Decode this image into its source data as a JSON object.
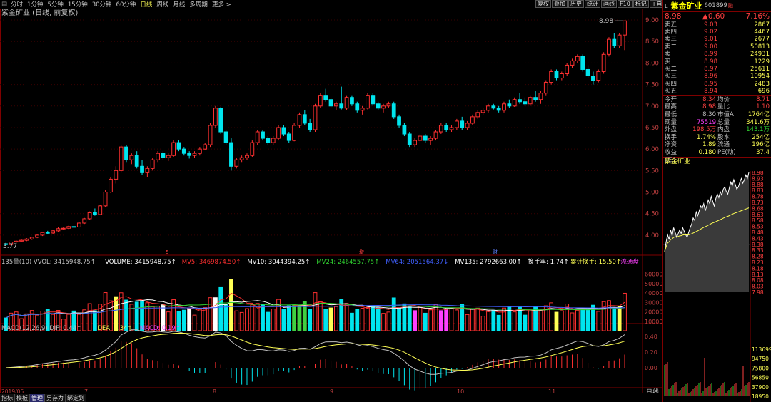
{
  "toolbar": {
    "items": [
      {
        "label": "分时",
        "active": false
      },
      {
        "label": "1分钟",
        "active": false
      },
      {
        "label": "5分钟",
        "active": false
      },
      {
        "label": "15分钟",
        "active": false
      },
      {
        "label": "30分钟",
        "active": false
      },
      {
        "label": "60分钟",
        "active": false
      },
      {
        "label": "日线",
        "active": true
      },
      {
        "label": "周线",
        "active": false
      },
      {
        "label": "月线",
        "active": false
      },
      {
        "label": "多周期",
        "active": false
      },
      {
        "label": "更多 >",
        "active": false
      }
    ],
    "right_buttons": [
      "复权",
      "叠加",
      "历史",
      "统计",
      "画线",
      "F10",
      "标记",
      "+自选",
      "返回"
    ]
  },
  "chart": {
    "title": "紫金矿业 (日线, 前复权)",
    "price_axis": [
      "9.00",
      "8.50",
      "8.00",
      "7.50",
      "7.00",
      "6.50",
      "6.00",
      "5.50",
      "5.00",
      "4.50",
      "4.00"
    ],
    "high_label": "8.98",
    "low_label": "3.77",
    "marker_labels": [
      "5",
      "增",
      "财"
    ],
    "volume_header": [
      {
        "text": "135量(10) VVOL: 3415948.75↑",
        "color": "#c0c0c0"
      },
      {
        "text": "VOLUME: 3415948.75↑",
        "color": "#ffffff"
      },
      {
        "text": "MV5: 3469874.50↑",
        "color": "#ff3030"
      },
      {
        "text": "MV10: 3044394.25↑",
        "color": "#ffffff"
      },
      {
        "text": "MV24: 2464557.75↑",
        "color": "#30d030"
      },
      {
        "text": "MV64: 2051564.37↓",
        "color": "#4060ff"
      },
      {
        "text": "MV135: 2792663.00↑",
        "color": "#ffffff"
      },
      {
        "text": "换手率: 1.74↑",
        "color": "#ffffff"
      },
      {
        "text": "累计换手: 15.50↑",
        "color": "#ffff55"
      },
      {
        "text": "流通盘",
        "color": "#ff40ff"
      }
    ],
    "volume_axis": [
      "60000",
      "50000",
      "40000",
      "30000",
      "20000",
      "10000"
    ],
    "macd_header": [
      {
        "text": "MACD(12,26,9) DIF: 0.44↑",
        "color": "#c0c0c0"
      },
      {
        "text": "DEA: 0.34↑",
        "color": "#ffff55"
      },
      {
        "text": "MACD: 0.19↑",
        "color": "#ff40ff"
      }
    ],
    "macd_axis": [
      "0.40",
      "0.20",
      "0.00"
    ],
    "date_axis": [
      "7",
      "8",
      "9",
      "10",
      "11"
    ],
    "date_year": "2019/06",
    "period_label": "日线"
  },
  "bottom_tabs": [
    {
      "label": "指标",
      "active": false
    },
    {
      "label": "模板",
      "active": false
    },
    {
      "label": "管理",
      "active": true
    },
    {
      "label": "另存为",
      "active": false
    },
    {
      "label": "绑定到",
      "active": false
    }
  ],
  "quote": {
    "mark": "L",
    "name": "紫金矿业",
    "code": "601899",
    "badge": "融",
    "price": "8.98",
    "change": "▲0.60",
    "change_pct": "7.16%",
    "asks": [
      {
        "label": "卖五",
        "price": "9.03",
        "vol": "2867"
      },
      {
        "label": "卖四",
        "price": "9.02",
        "vol": "4467"
      },
      {
        "label": "卖三",
        "price": "9.01",
        "vol": "2677"
      },
      {
        "label": "卖二",
        "price": "9.00",
        "vol": "50813"
      },
      {
        "label": "卖一",
        "price": "8.99",
        "vol": "24931"
      }
    ],
    "bids": [
      {
        "label": "买一",
        "price": "8.98",
        "vol": "1229"
      },
      {
        "label": "买二",
        "price": "8.97",
        "vol": "25611"
      },
      {
        "label": "买三",
        "price": "8.96",
        "vol": "10954"
      },
      {
        "label": "买四",
        "price": "8.95",
        "vol": "2483"
      },
      {
        "label": "买五",
        "price": "8.94",
        "vol": "696"
      }
    ],
    "stats": [
      {
        "k": "今开",
        "a": "8.34",
        "ac": "#ff4040",
        "k2": "均价",
        "b": "8.71",
        "bc": "#ff4040"
      },
      {
        "k": "最高",
        "a": "8.98",
        "ac": "#ff4040",
        "k2": "量比",
        "b": "1.10",
        "bc": "#ff4040"
      },
      {
        "k": "最低",
        "a": "8.30",
        "ac": "#c0c0c0",
        "k2": "市值A",
        "b": "1764亿",
        "bc": "#ffff55"
      },
      {
        "k": "现量",
        "a": "75519",
        "ac": "#ff40ff",
        "k2": "总量",
        "b": "341.6万",
        "bc": "#ffff55"
      },
      {
        "k": "外盘",
        "a": "198.5万",
        "ac": "#ff4040",
        "k2": "内盘",
        "b": "143.1万",
        "bc": "#30d030"
      },
      {
        "k": "换手",
        "a": "1.74%",
        "ac": "#ffff55",
        "k2": "股本",
        "b": "254亿",
        "bc": "#ffff55"
      },
      {
        "k": "净资",
        "a": "1.89",
        "ac": "#ffff55",
        "k2": "流通",
        "b": "196亿",
        "bc": "#ffff55"
      },
      {
        "k": "收益(三)",
        "a": "0.180",
        "ac": "#ffff55",
        "k2": "PE(动)",
        "b": "37.4",
        "bc": "#ffff55"
      }
    ],
    "mini_title": "紫金矿业",
    "mini_price_axis": [
      "8.98",
      "8.93",
      "8.88",
      "8.83",
      "8.78",
      "8.73",
      "8.68",
      "8.63",
      "8.58",
      "8.53",
      "8.48",
      "8.43",
      "8.38",
      "8.33",
      "8.28",
      "8.23",
      "8.18",
      "8.13",
      "8.08",
      "8.03",
      "7.98"
    ],
    "mini_vol_axis": [
      "113699",
      "94750",
      "75800",
      "56850",
      "37900",
      "18950"
    ]
  },
  "colors": {
    "up": "#ff3030",
    "down": "#00e5ee",
    "grid": "#800000",
    "bg": "#000000",
    "text": "#c0c0c0",
    "yellow": "#ffff55"
  },
  "candles": [
    [
      3.8,
      3.82,
      3.75,
      3.78
    ],
    [
      3.78,
      3.85,
      3.76,
      3.84
    ],
    [
      3.84,
      3.88,
      3.82,
      3.86
    ],
    [
      3.86,
      3.9,
      3.85,
      3.88
    ],
    [
      3.88,
      3.93,
      3.86,
      3.91
    ],
    [
      3.91,
      3.96,
      3.89,
      3.95
    ],
    [
      3.95,
      4.02,
      3.93,
      4.0
    ],
    [
      4.0,
      4.08,
      3.98,
      4.06
    ],
    [
      4.06,
      4.1,
      4.02,
      4.05
    ],
    [
      4.05,
      4.12,
      4.03,
      4.1
    ],
    [
      4.1,
      4.18,
      4.08,
      4.15
    ],
    [
      4.15,
      4.18,
      4.12,
      4.16
    ],
    [
      4.16,
      4.22,
      4.14,
      4.2
    ],
    [
      4.2,
      4.25,
      4.17,
      4.19
    ],
    [
      4.19,
      4.3,
      4.18,
      4.28
    ],
    [
      4.28,
      4.4,
      4.26,
      4.38
    ],
    [
      4.38,
      4.55,
      4.36,
      4.52
    ],
    [
      4.52,
      4.62,
      4.45,
      4.48
    ],
    [
      4.48,
      4.7,
      4.47,
      4.68
    ],
    [
      4.68,
      5.05,
      4.66,
      5.0
    ],
    [
      5.0,
      5.35,
      4.98,
      5.3
    ],
    [
      5.3,
      5.6,
      5.2,
      5.5
    ],
    [
      5.5,
      6.1,
      5.45,
      6.05
    ],
    [
      6.05,
      6.1,
      5.7,
      5.75
    ],
    [
      5.75,
      5.9,
      5.65,
      5.85
    ],
    [
      5.85,
      5.95,
      5.55,
      5.6
    ],
    [
      5.6,
      5.75,
      5.4,
      5.45
    ],
    [
      5.45,
      5.6,
      5.35,
      5.55
    ],
    [
      5.55,
      5.8,
      5.5,
      5.75
    ],
    [
      5.75,
      5.95,
      5.7,
      5.9
    ],
    [
      5.9,
      5.95,
      5.75,
      5.8
    ],
    [
      5.8,
      5.9,
      5.72,
      5.85
    ],
    [
      5.85,
      6.2,
      5.82,
      6.15
    ],
    [
      6.15,
      6.2,
      5.95,
      6.0
    ],
    [
      6.0,
      6.05,
      5.85,
      5.9
    ],
    [
      5.9,
      5.95,
      5.78,
      5.85
    ],
    [
      5.85,
      5.95,
      5.8,
      5.9
    ],
    [
      5.9,
      6.05,
      5.85,
      6.0
    ],
    [
      6.0,
      6.15,
      5.98,
      6.1
    ],
    [
      6.1,
      6.6,
      6.05,
      6.55
    ],
    [
      6.55,
      7.0,
      6.5,
      6.95
    ],
    [
      6.95,
      6.98,
      6.35,
      6.4
    ],
    [
      6.4,
      6.45,
      6.1,
      6.15
    ],
    [
      6.15,
      6.25,
      5.5,
      5.6
    ],
    [
      5.6,
      5.8,
      5.55,
      5.75
    ],
    [
      5.75,
      5.85,
      5.7,
      5.8
    ],
    [
      5.8,
      5.9,
      5.74,
      5.85
    ],
    [
      5.85,
      6.2,
      5.82,
      6.15
    ],
    [
      6.15,
      6.45,
      6.1,
      6.4
    ],
    [
      6.4,
      6.45,
      6.2,
      6.25
    ],
    [
      6.25,
      6.3,
      6.1,
      6.15
    ],
    [
      6.15,
      6.3,
      6.1,
      6.25
    ],
    [
      6.25,
      6.55,
      6.2,
      6.5
    ],
    [
      6.5,
      6.55,
      6.3,
      6.35
    ],
    [
      6.35,
      6.4,
      6.15,
      6.2
    ],
    [
      6.2,
      6.6,
      6.18,
      6.55
    ],
    [
      6.55,
      6.85,
      6.5,
      6.8
    ],
    [
      6.8,
      6.9,
      6.55,
      6.6
    ],
    [
      6.6,
      6.7,
      6.4,
      6.45
    ],
    [
      6.45,
      7.05,
      6.4,
      7.0
    ],
    [
      7.0,
      7.3,
      6.95,
      7.25
    ],
    [
      7.25,
      7.4,
      7.1,
      7.15
    ],
    [
      7.15,
      7.2,
      6.95,
      7.0
    ],
    [
      7.0,
      7.1,
      6.9,
      7.05
    ],
    [
      7.05,
      7.45,
      6.92,
      6.95
    ],
    [
      6.95,
      7.25,
      6.9,
      7.2
    ],
    [
      7.2,
      7.25,
      7.0,
      7.05
    ],
    [
      7.05,
      7.1,
      6.85,
      6.9
    ],
    [
      6.9,
      7.0,
      6.8,
      6.95
    ],
    [
      6.95,
      7.3,
      6.92,
      7.25
    ],
    [
      7.25,
      7.3,
      7.0,
      7.05
    ],
    [
      7.05,
      7.1,
      6.9,
      6.95
    ],
    [
      6.95,
      7.05,
      6.85,
      7.0
    ],
    [
      7.0,
      7.1,
      6.95,
      7.05
    ],
    [
      7.05,
      7.1,
      6.7,
      6.75
    ],
    [
      6.75,
      6.8,
      6.5,
      6.55
    ],
    [
      6.55,
      6.6,
      6.3,
      6.35
    ],
    [
      6.35,
      6.4,
      6.05,
      6.1
    ],
    [
      6.1,
      6.25,
      6.05,
      6.2
    ],
    [
      6.2,
      6.35,
      6.15,
      6.3
    ],
    [
      6.3,
      6.35,
      6.15,
      6.2
    ],
    [
      6.2,
      6.3,
      6.1,
      6.25
    ],
    [
      6.25,
      6.45,
      6.2,
      6.4
    ],
    [
      6.4,
      6.6,
      6.35,
      6.55
    ],
    [
      6.55,
      6.6,
      6.4,
      6.45
    ],
    [
      6.45,
      6.55,
      6.4,
      6.5
    ],
    [
      6.5,
      6.7,
      6.45,
      6.65
    ],
    [
      6.65,
      6.75,
      6.45,
      6.5
    ],
    [
      6.5,
      6.65,
      6.45,
      6.6
    ],
    [
      6.6,
      6.8,
      6.55,
      6.75
    ],
    [
      6.75,
      6.9,
      6.7,
      6.85
    ],
    [
      6.85,
      6.95,
      6.8,
      6.9
    ],
    [
      6.9,
      7.05,
      6.85,
      7.0
    ],
    [
      7.0,
      7.05,
      6.92,
      6.95
    ],
    [
      6.95,
      7.0,
      6.85,
      6.9
    ],
    [
      6.9,
      7.1,
      6.85,
      7.05
    ],
    [
      7.05,
      7.15,
      6.95,
      7.0
    ],
    [
      7.0,
      7.2,
      6.98,
      7.15
    ],
    [
      7.15,
      7.3,
      7.05,
      7.1
    ],
    [
      7.1,
      7.2,
      7.0,
      7.05
    ],
    [
      7.05,
      7.25,
      7.0,
      7.2
    ],
    [
      7.2,
      7.35,
      7.1,
      7.15
    ],
    [
      7.15,
      7.35,
      7.05,
      7.3
    ],
    [
      7.3,
      7.6,
      7.25,
      7.55
    ],
    [
      7.55,
      7.85,
      7.5,
      7.8
    ],
    [
      7.8,
      7.85,
      7.6,
      7.65
    ],
    [
      7.65,
      7.8,
      7.6,
      7.75
    ],
    [
      7.75,
      8.0,
      7.7,
      7.95
    ],
    [
      7.95,
      8.1,
      7.88,
      8.05
    ],
    [
      8.05,
      8.2,
      8.0,
      8.15
    ],
    [
      8.15,
      8.2,
      7.8,
      7.85
    ],
    [
      7.85,
      7.95,
      7.65,
      7.7
    ],
    [
      7.7,
      7.8,
      7.5,
      7.6
    ],
    [
      7.6,
      7.85,
      7.55,
      7.8
    ],
    [
      7.8,
      8.25,
      7.75,
      8.2
    ],
    [
      8.2,
      8.6,
      8.15,
      8.55
    ],
    [
      8.55,
      8.7,
      8.35,
      8.4
    ],
    [
      8.4,
      8.7,
      8.35,
      8.65
    ],
    [
      8.65,
      8.98,
      8.3,
      8.98
    ]
  ],
  "intraday": [
    8.32,
    8.4,
    8.46,
    8.42,
    8.5,
    8.45,
    8.52,
    8.48,
    8.44,
    8.47,
    8.5,
    8.47,
    8.52,
    8.49,
    8.46,
    8.44,
    8.48,
    8.52,
    8.55,
    8.6,
    8.58,
    8.65,
    8.62,
    8.66,
    8.7,
    8.68,
    8.72,
    8.66,
    8.7,
    8.75,
    8.72,
    8.78,
    8.74,
    8.7,
    8.76,
    8.8,
    8.77,
    8.82,
    8.79,
    8.84,
    8.86,
    8.82,
    8.8,
    8.85,
    8.9,
    8.87,
    8.92,
    8.88,
    8.84,
    8.86,
    8.9,
    8.93,
    8.89,
    8.92,
    8.96,
    8.93,
    8.98
  ]
}
